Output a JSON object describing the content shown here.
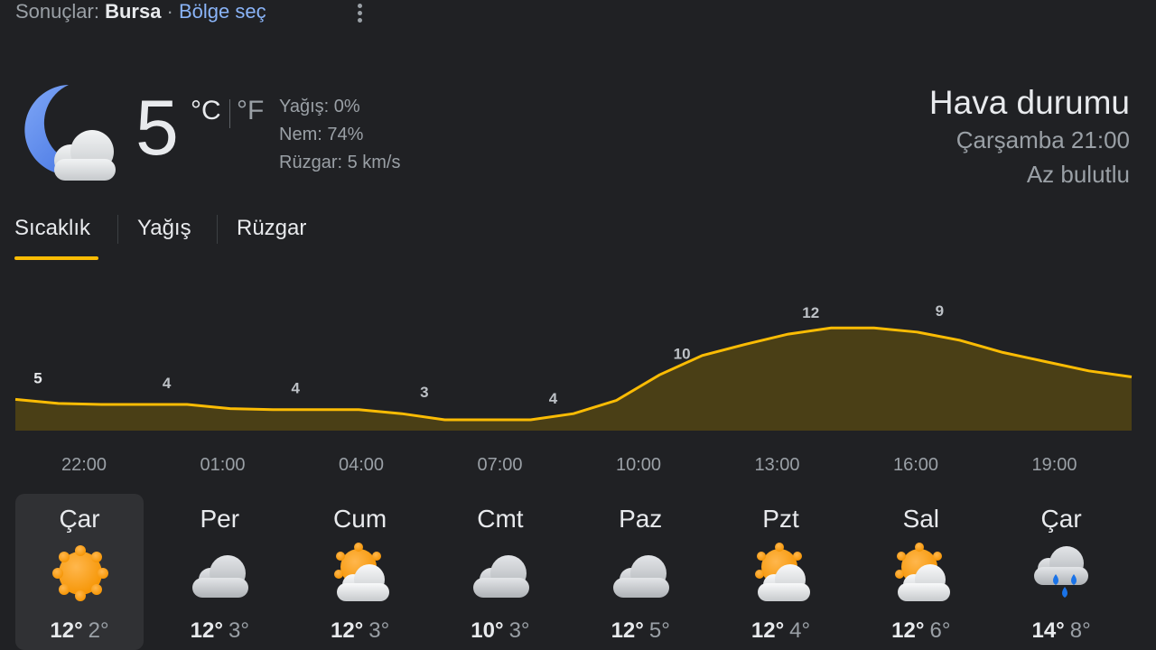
{
  "header": {
    "prefix": "Sonuçlar:",
    "location": "Bursa",
    "separator": " · ",
    "choose_region": "Bölge seç",
    "more_icon": "more-vert-icon"
  },
  "current": {
    "icon": "moon-cloud-icon",
    "temperature": "5",
    "unit_c": "°C",
    "unit_f": "°F",
    "precipitation": "Yağış: 0%",
    "humidity": "Nem: 74%",
    "wind": "Rüzgar: 5 km/s"
  },
  "summary": {
    "title": "Hava durumu",
    "datetime": "Çarşamba 21:00",
    "condition": "Az bulutlu"
  },
  "tabs": [
    {
      "label": "Sıcaklık",
      "active": true
    },
    {
      "label": "Yağış",
      "active": false
    },
    {
      "label": "Rüzgar",
      "active": false
    }
  ],
  "chart_data": {
    "type": "area",
    "x": [
      "21:00",
      "22:00",
      "23:00",
      "00:00",
      "01:00",
      "02:00",
      "03:00",
      "04:00",
      "05:00",
      "06:00",
      "07:00",
      "08:00",
      "09:00",
      "10:00",
      "11:00",
      "12:00",
      "13:00",
      "14:00",
      "15:00",
      "16:00",
      "17:00",
      "18:00",
      "19:00",
      "20:00",
      "21:00"
    ],
    "values": [
      5,
      4.6,
      4.5,
      4.5,
      4.5,
      4.1,
      4,
      4,
      4,
      3.6,
      3,
      3,
      3,
      3.6,
      4.9,
      7.4,
      9.3,
      10.4,
      11.4,
      12,
      12,
      11.6,
      10.8,
      9.6,
      8.7,
      7.8,
      7.2
    ],
    "labels": [
      {
        "text": "5"
      },
      {
        "text": "4"
      },
      {
        "text": "4"
      },
      {
        "text": "3"
      },
      {
        "text": "4"
      },
      {
        "text": "10"
      },
      {
        "text": "12"
      },
      {
        "text": "9"
      }
    ],
    "tick_labels": [
      "22:00",
      "01:00",
      "04:00",
      "07:00",
      "10:00",
      "13:00",
      "16:00",
      "19:00"
    ],
    "line_color": "#fbbc04",
    "fill_color": "#4a3f16"
  },
  "days": [
    {
      "name": "Çar",
      "icon": "sun-icon",
      "high": "12°",
      "low": "2°",
      "selected": true
    },
    {
      "name": "Per",
      "icon": "cloud-icon",
      "high": "12°",
      "low": "3°",
      "selected": false
    },
    {
      "name": "Cum",
      "icon": "partly-cloudy-icon",
      "high": "12°",
      "low": "3°",
      "selected": false
    },
    {
      "name": "Cmt",
      "icon": "cloud-icon",
      "high": "10°",
      "low": "3°",
      "selected": false
    },
    {
      "name": "Paz",
      "icon": "cloud-icon",
      "high": "12°",
      "low": "5°",
      "selected": false
    },
    {
      "name": "Pzt",
      "icon": "partly-cloudy-icon",
      "high": "12°",
      "low": "4°",
      "selected": false
    },
    {
      "name": "Sal",
      "icon": "partly-cloudy-icon",
      "high": "12°",
      "low": "6°",
      "selected": false
    },
    {
      "name": "Çar",
      "icon": "rain-icon",
      "high": "14°",
      "low": "8°",
      "selected": false
    }
  ]
}
